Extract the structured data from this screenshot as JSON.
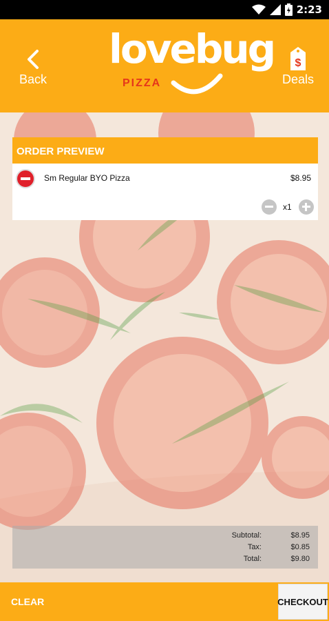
{
  "status_bar": {
    "time": "2:23",
    "icons": [
      "wifi-icon",
      "signal-icon",
      "battery-charging-icon"
    ]
  },
  "header": {
    "back_label": "Back",
    "logo_word": "lovebug",
    "logo_sub": "PIZZA",
    "deals_label": "Deals",
    "deals_icon_glyph": "$"
  },
  "order_preview": {
    "title": "ORDER PREVIEW",
    "items": [
      {
        "name": "Sm Regular BYO Pizza",
        "price": "$8.95",
        "quantity": "x1"
      }
    ]
  },
  "totals": {
    "subtotal_label": "Subtotal:",
    "subtotal_value": "$8.95",
    "tax_label": "Tax:",
    "tax_value": "$0.85",
    "total_label": "Total:",
    "total_value": "$9.80"
  },
  "footer": {
    "clear_label": "CLEAR",
    "checkout_label": "CHECKOUT"
  },
  "colors": {
    "brand_orange": "#fcac16",
    "logo_red": "#e5361b",
    "remove_red": "#e0202a"
  }
}
